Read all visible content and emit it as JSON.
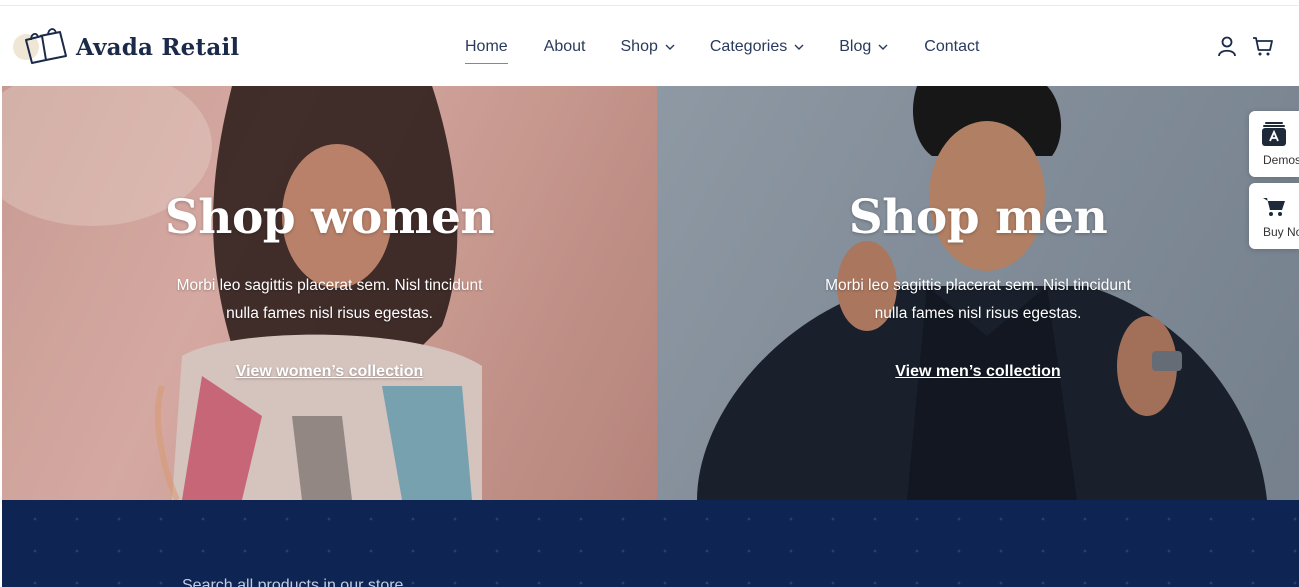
{
  "brand": {
    "name": "Avada Retail"
  },
  "nav": {
    "items": [
      {
        "label": "Home"
      },
      {
        "label": "About"
      },
      {
        "label": "Shop"
      },
      {
        "label": "Categories"
      },
      {
        "label": "Blog"
      },
      {
        "label": "Contact"
      }
    ],
    "active": "Home"
  },
  "header_icons": [
    "user-icon",
    "cart-icon"
  ],
  "hero": {
    "women": {
      "title": "Shop women",
      "description": "Morbi leo sagittis placerat sem. Nisl tincidunt nulla fames nisl risus egestas.",
      "link": "View women’s collection"
    },
    "men": {
      "title": "Shop men",
      "description": "Morbi leo sagittis placerat sem. Nisl tincidunt nulla fames nisl risus egestas.",
      "link": "View men’s collection"
    }
  },
  "side_widgets": [
    {
      "label": "Demos",
      "icon": "demos-icon"
    },
    {
      "label": "Buy Now",
      "icon": "shopping-cart-icon"
    }
  ],
  "search": {
    "placeholder": "Search all products in our store"
  },
  "colors": {
    "navy": "#0e2452",
    "text": "#1b2a4a",
    "white": "#ffffff"
  }
}
